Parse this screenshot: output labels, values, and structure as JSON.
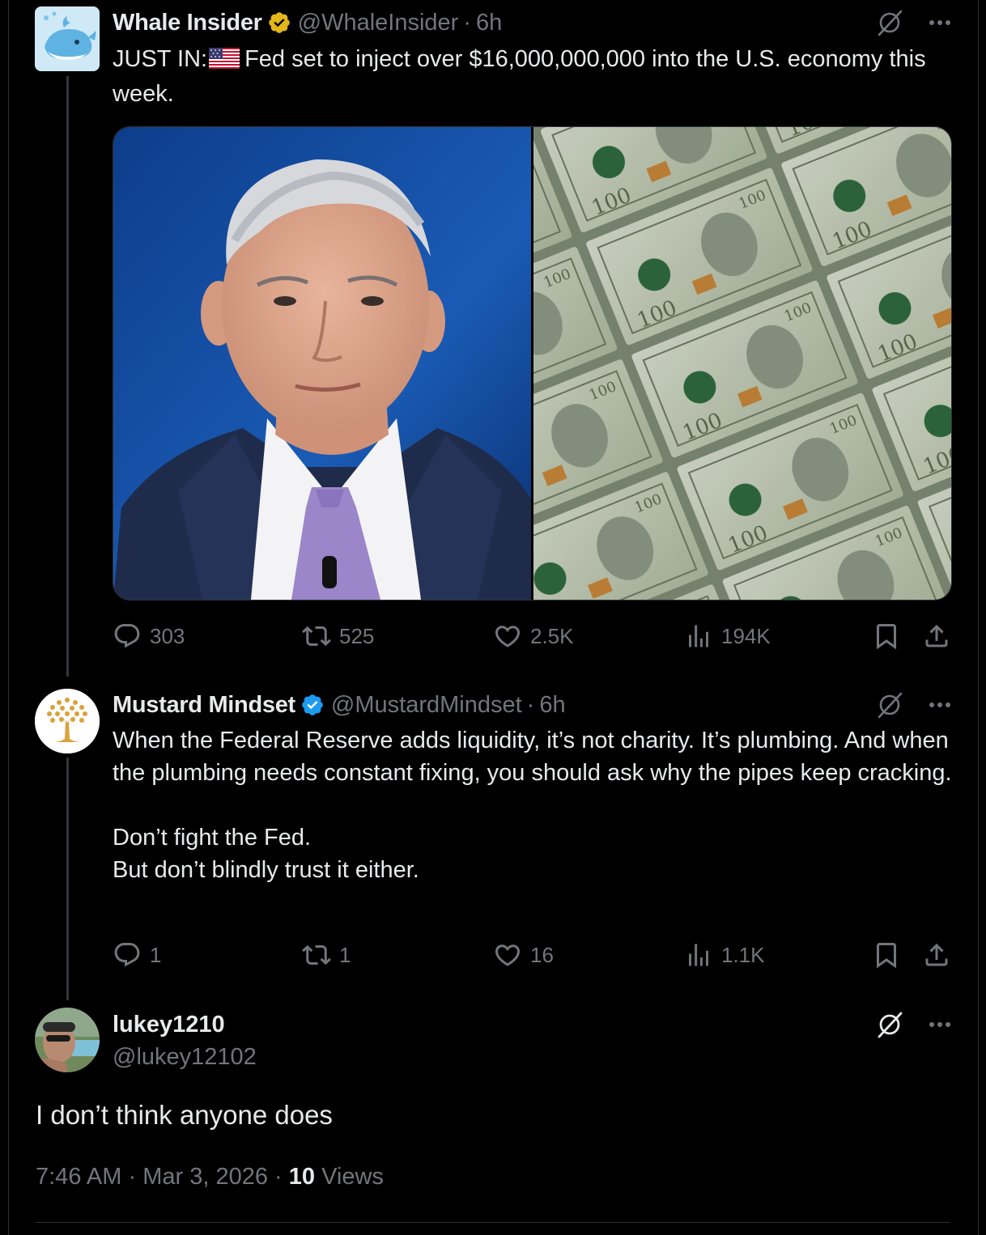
{
  "colors": {
    "background": "#000000",
    "text_primary": "#e7e9ea",
    "text_secondary": "#71767b",
    "verified_blue": "#1d9bf0",
    "verified_gold": "#e2b719",
    "border": "#2f3336"
  },
  "original_post": {
    "display_name": "Whale Insider",
    "verified": "gold",
    "handle": "@WhaleInsider",
    "separator": "·",
    "time": "6h",
    "text_prefix": "JUST IN:",
    "flag_icon": "us-flag-icon",
    "text_body": "Fed set to inject over $16,000,000,000 into the U.S. economy this week.",
    "media": [
      "portrait-photo",
      "stacked-100-dollar-bills-photo"
    ],
    "stats": {
      "replies": "303",
      "reposts": "525",
      "likes": "2.5K",
      "views": "194K"
    }
  },
  "quoted_reply": {
    "display_name": "Mustard Mindset",
    "verified": "blue",
    "handle": "@MustardMindset",
    "separator": "·",
    "time": "6h",
    "text": "When the Federal Reserve adds liquidity, it’s not charity. It’s plumbing. And when the plumbing needs constant fixing, you should ask why the pipes keep cracking.\n\nDon’t fight the Fed.\nBut don’t blindly trust it either.",
    "stats": {
      "replies": "1",
      "reposts": "1",
      "likes": "16",
      "views": "1.1K"
    }
  },
  "main_reply": {
    "display_name": "lukey1210",
    "handle": "@lukey12102",
    "text": "I don’t think anyone does",
    "time": "7:46 AM",
    "sep1": "·",
    "date": "Mar 3, 2026",
    "sep2": "·",
    "views_count": "10",
    "views_label": "Views"
  }
}
